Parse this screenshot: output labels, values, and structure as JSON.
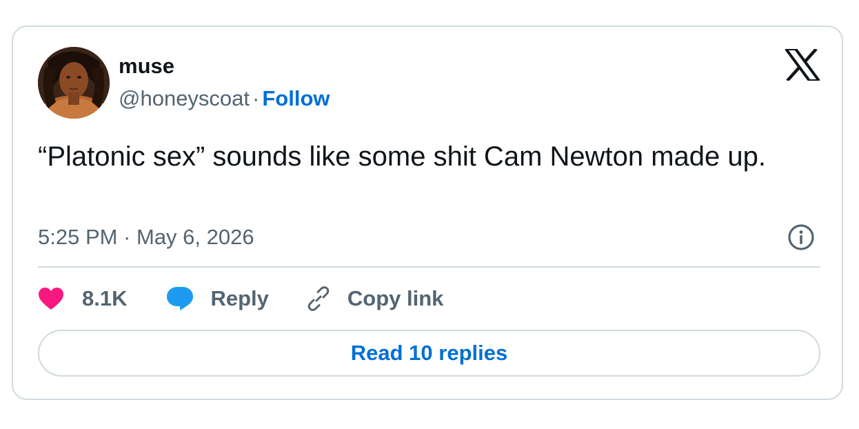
{
  "author": {
    "display_name": "muse",
    "handle": "@honeyscoat",
    "separator": "·",
    "follow_label": "Follow"
  },
  "tweet": {
    "text": "“Platonic sex” sounds like some shit Cam Newton made up.",
    "timestamp": "5:25 PM · May 6, 2026"
  },
  "actions": {
    "like_count": "8.1K",
    "reply_label": "Reply",
    "copy_link_label": "Copy link"
  },
  "read_replies_label": "Read 10 replies",
  "icons": {
    "brand": "x-logo-icon",
    "info": "info-icon",
    "like": "heart-icon",
    "reply": "speech-bubble-icon",
    "copy": "link-icon"
  },
  "colors": {
    "like": "#f91880",
    "reply": "#1d9bf0",
    "link": "#006fd6",
    "secondary_text": "#536471",
    "border": "#cfd9de"
  }
}
